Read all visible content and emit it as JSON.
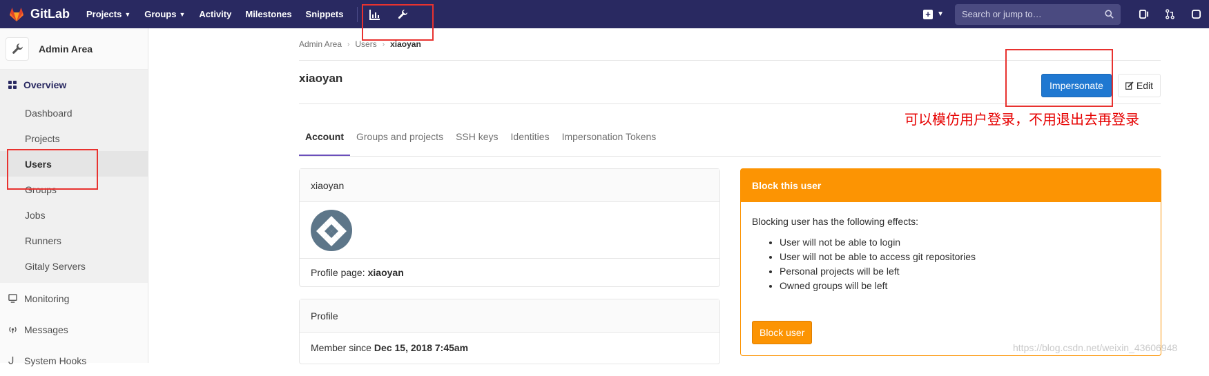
{
  "topbar": {
    "brand": "GitLab",
    "nav": [
      {
        "label": "Projects",
        "dropdown": true
      },
      {
        "label": "Groups",
        "dropdown": true
      },
      {
        "label": "Activity",
        "dropdown": false
      },
      {
        "label": "Milestones",
        "dropdown": false
      },
      {
        "label": "Snippets",
        "dropdown": false
      }
    ],
    "search_placeholder": "Search or jump to…",
    "icons": [
      "chart-icon",
      "wrench-icon",
      "plus-icon",
      "search-icon",
      "issues-icon",
      "merge-request-icon",
      "todo-icon"
    ]
  },
  "sidebar": {
    "title": "Admin Area",
    "overview_label": "Overview",
    "sub_items": [
      "Dashboard",
      "Projects",
      "Users",
      "Groups",
      "Jobs",
      "Runners",
      "Gitaly Servers"
    ],
    "active_item": "Users",
    "main_items": [
      "Monitoring",
      "Messages",
      "System Hooks"
    ]
  },
  "breadcrumb": {
    "items": [
      "Admin Area",
      "Users"
    ],
    "current": "xiaoyan"
  },
  "page": {
    "title": "xiaoyan",
    "impersonate_label": "Impersonate",
    "edit_label": "Edit",
    "annotation": "可以模仿用户登录，不用退出去再登录"
  },
  "tabs": [
    "Account",
    "Groups and projects",
    "SSH keys",
    "Identities",
    "Impersonation Tokens"
  ],
  "active_tab": "Account",
  "user_card": {
    "name": "xiaoyan",
    "profile_label": "Profile page:",
    "profile_value": "xiaoyan"
  },
  "profile_card": {
    "title": "Profile",
    "member_label": "Member since",
    "member_value": "Dec 15, 2018 7:45am"
  },
  "block_card": {
    "title": "Block this user",
    "intro": "Blocking user has the following effects:",
    "effects": [
      "User will not be able to login",
      "User will not be able to access git repositories",
      "Personal projects will be left",
      "Owned groups will be left"
    ],
    "button_label": "Block user"
  },
  "watermark": "https://blog.csdn.net/weixin_43606948",
  "colors": {
    "navbar": "#292961",
    "primary": "#1f78d1",
    "warning": "#fc9403",
    "annotation": "#e60000"
  }
}
